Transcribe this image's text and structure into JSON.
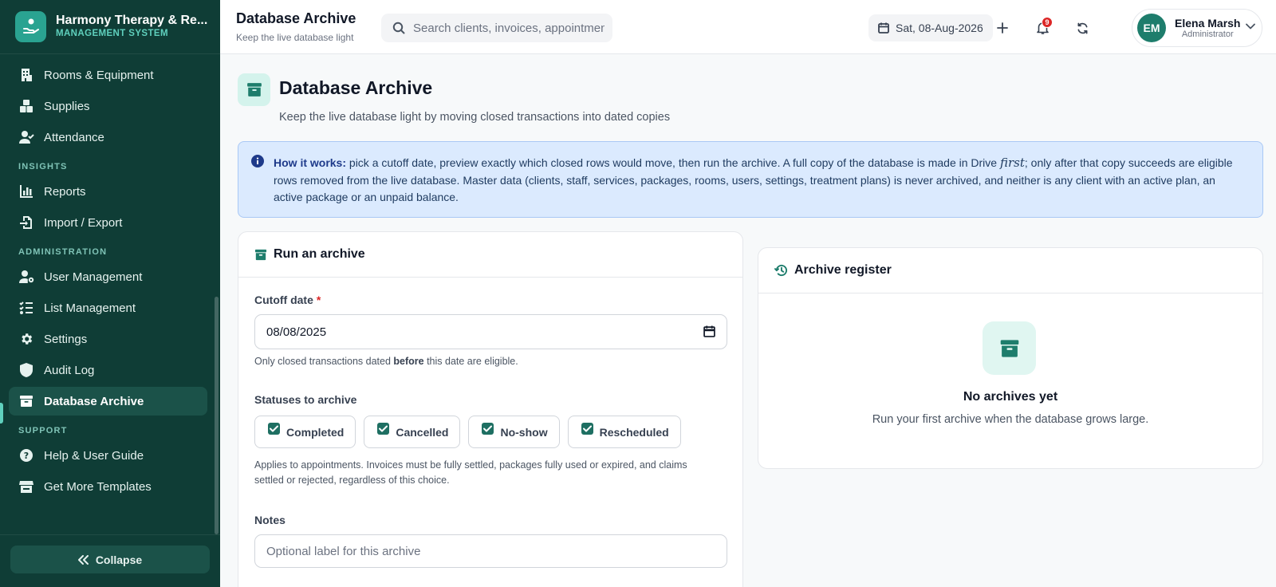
{
  "brand": {
    "title": "Harmony Therapy & Re...",
    "subtitle": "MANAGEMENT SYSTEM"
  },
  "sidebar": {
    "items_top": [
      {
        "label": "Rooms & Equipment",
        "icon": "building-icon"
      },
      {
        "label": "Supplies",
        "icon": "boxes-icon"
      },
      {
        "label": "Attendance",
        "icon": "user-check-icon"
      }
    ],
    "section_insights": "INSIGHTS",
    "items_insights": [
      {
        "label": "Reports",
        "icon": "bar-chart-icon"
      },
      {
        "label": "Import / Export",
        "icon": "file-import-icon"
      }
    ],
    "section_admin": "ADMINISTRATION",
    "items_admin": [
      {
        "label": "User Management",
        "icon": "user-gear-icon"
      },
      {
        "label": "List Management",
        "icon": "list-check-icon"
      },
      {
        "label": "Settings",
        "icon": "gear-icon"
      },
      {
        "label": "Audit Log",
        "icon": "shield-icon"
      },
      {
        "label": "Database Archive",
        "icon": "archive-icon",
        "active": true
      }
    ],
    "section_support": "SUPPORT",
    "items_support": [
      {
        "label": "Help & User Guide",
        "icon": "help-circle-icon"
      },
      {
        "label": "Get More Templates",
        "icon": "store-icon"
      }
    ],
    "collapse_label": "Collapse"
  },
  "header": {
    "title": "Database Archive",
    "subtitle": "Keep the live database light",
    "search_placeholder": "Search clients, invoices, appointments...",
    "date": "Sat, 08-Aug-2026",
    "notification_count": "9",
    "user": {
      "initials": "EM",
      "name": "Elena Marsh",
      "role": "Administrator"
    }
  },
  "page": {
    "title": "Database Archive",
    "subtitle": "Keep the live database light by moving closed transactions into dated copies",
    "info": {
      "lead": "How it works:",
      "text1": " pick a cutoff date, preview exactly which closed rows would move, then run the archive. A full copy of the database is made in Drive ",
      "emph": "first",
      "text2": "; only after that copy succeeds are eligible rows removed from the live database. Master data (clients, staff, services, packages, rooms, users, settings, treatment plans) is never archived, and neither is any client with an active plan, an active package or an unpaid balance."
    }
  },
  "run_archive": {
    "title": "Run an archive",
    "cutoff_label": "Cutoff date",
    "required_mark": "*",
    "cutoff_value": "08/08/2025",
    "cutoff_hint_pre": "Only closed transactions dated ",
    "cutoff_hint_bold": "before",
    "cutoff_hint_post": " this date are eligible.",
    "statuses_label": "Statuses to archive",
    "statuses": [
      {
        "label": "Completed",
        "checked": true
      },
      {
        "label": "Cancelled",
        "checked": true
      },
      {
        "label": "No-show",
        "checked": true
      },
      {
        "label": "Rescheduled",
        "checked": true
      }
    ],
    "statuses_hint": "Applies to appointments. Invoices must be fully settled, packages fully used or expired, and claims settled or rejected, regardless of this choice.",
    "notes_label": "Notes",
    "notes_placeholder": "Optional label for this archive"
  },
  "register": {
    "title": "Archive register",
    "empty_title": "No archives yet",
    "empty_subtitle": "Run your first archive when the database grows large."
  },
  "colors": {
    "sidebar_bg": "#0f3d36",
    "accent": "#1e7d6c",
    "info_bg": "#dbeafe"
  }
}
